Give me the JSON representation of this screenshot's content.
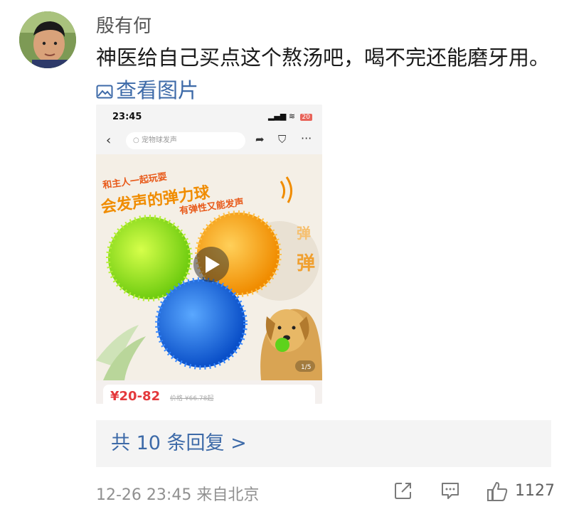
{
  "comment": {
    "username": "殷有何",
    "text": "神医给自己买点这个熬汤吧，喝不完还能磨牙用。",
    "view_image": "查看图片"
  },
  "screenshot": {
    "status": {
      "time": "23:45",
      "battery": "20"
    },
    "search_placeholder": "宠物球发声",
    "banner": {
      "line1": "和主人一起玩耍",
      "line2": "会发声的弹力球",
      "line3": "有弹性又能发声",
      "side1": "弹",
      "side2": "弹"
    },
    "image_counter": "1/5",
    "price": "¥20-82",
    "original_price": "价格 ¥66.78起"
  },
  "replies": "共 10 条回复 >",
  "meta": {
    "time": "12-26 23:45",
    "location": "来自北京"
  },
  "actions": {
    "likes": "1127"
  },
  "colors": {
    "link": "#3d6aa8",
    "price": "#e4393c",
    "banner_orange": "#f08c00"
  },
  "icons": [
    "image-icon",
    "share-icon",
    "comment-icon",
    "like-icon",
    "play-icon",
    "back-icon",
    "cart-icon",
    "more-icon"
  ]
}
